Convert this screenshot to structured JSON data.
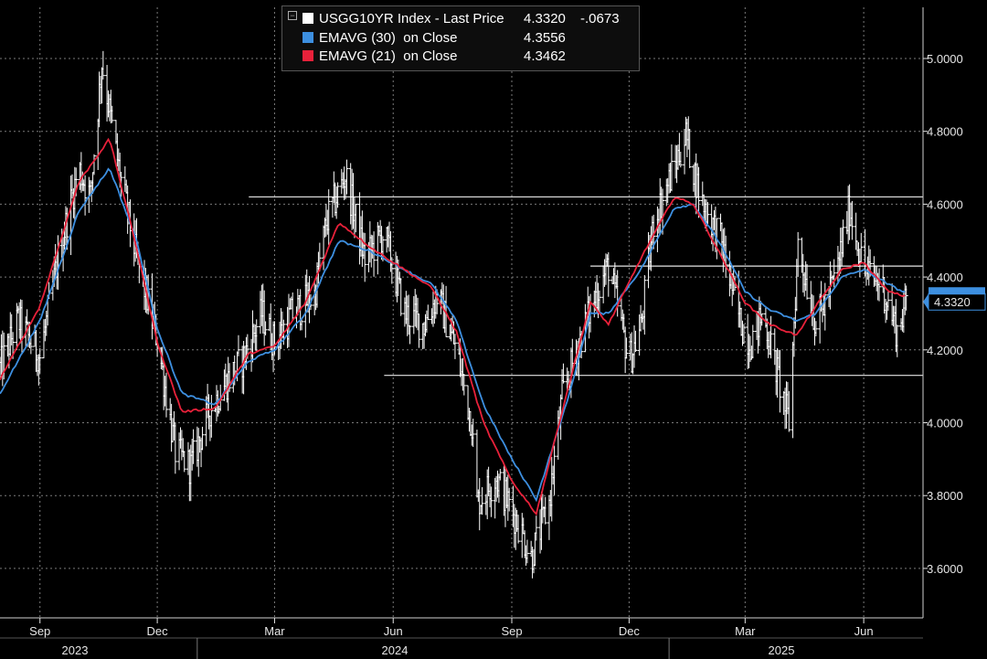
{
  "colors": {
    "background": "#000000",
    "grid": "#7a7a7a",
    "price": "#ffffff",
    "ema30": "#3d8fe0",
    "ema21": "#e8213a",
    "axis_text": "#e6e6e6",
    "last_price_tag_bg": "#ffffff",
    "last_price_tag_border": "#3d8fe0"
  },
  "legend": {
    "collapse_icon": "minus-box-icon",
    "rows": [
      {
        "swatch": "#ffffff",
        "name": "USGG10YR Index - Last Price",
        "value": "4.3320",
        "change": "-.0673"
      },
      {
        "swatch": "#3d8fe0",
        "name": "EMAVG (30)  on Close",
        "value": "4.3556",
        "change": ""
      },
      {
        "swatch": "#e8213a",
        "name": "EMAVG (21)  on Close",
        "value": "4.3462",
        "change": ""
      }
    ]
  },
  "last_price_tag": "4.3320",
  "chart_data": {
    "type": "line",
    "title": "",
    "xlabel": "",
    "ylabel": "",
    "ylim": [
      3.45,
      5.12
    ],
    "y_ticks": [
      "5.0000",
      "4.8000",
      "4.6000",
      "4.4000",
      "4.2000",
      "4.0000",
      "3.8000",
      "3.6000"
    ],
    "x_ticks": [
      "Sep",
      "Dec",
      "Mar",
      "Jun",
      "Sep",
      "Dec",
      "Mar",
      "Jun"
    ],
    "x_years": [
      "2023",
      "2024",
      "2025"
    ],
    "grid": true,
    "legend_position": "top-center",
    "horizontal_levels": [
      4.62,
      4.43,
      4.13
    ],
    "series": [
      {
        "name": "USGG10YR Index - Last Price",
        "x": [
          "2023-08-01",
          "2023-08-15",
          "2023-09-01",
          "2023-09-15",
          "2023-10-01",
          "2023-10-10",
          "2023-10-19",
          "2023-11-01",
          "2023-11-15",
          "2023-12-01",
          "2023-12-15",
          "2023-12-27",
          "2024-01-10",
          "2024-01-25",
          "2024-02-05",
          "2024-02-20",
          "2024-03-01",
          "2024-03-15",
          "2024-04-01",
          "2024-04-10",
          "2024-04-25",
          "2024-05-10",
          "2024-05-25",
          "2024-06-10",
          "2024-06-25",
          "2024-07-05",
          "2024-07-20",
          "2024-08-01",
          "2024-08-05",
          "2024-08-20",
          "2024-09-05",
          "2024-09-16",
          "2024-09-30",
          "2024-10-10",
          "2024-10-25",
          "2024-11-05",
          "2024-11-15",
          "2024-12-01",
          "2024-12-10",
          "2024-12-20",
          "2025-01-05",
          "2025-01-14",
          "2025-01-25",
          "2025-02-10",
          "2025-02-25",
          "2025-03-05",
          "2025-03-15",
          "2025-04-04",
          "2025-04-11",
          "2025-04-25",
          "2025-05-10",
          "2025-05-21",
          "2025-06-01",
          "2025-06-15",
          "2025-06-27",
          "2025-07-04"
        ],
        "values": [
          4.15,
          4.28,
          4.18,
          4.45,
          4.7,
          4.62,
          4.99,
          4.7,
          4.45,
          4.23,
          3.92,
          3.88,
          4.03,
          4.12,
          4.17,
          4.3,
          4.22,
          4.3,
          4.35,
          4.55,
          4.68,
          4.45,
          4.52,
          4.3,
          4.27,
          4.35,
          4.2,
          4.0,
          3.78,
          3.85,
          3.73,
          3.63,
          3.78,
          4.07,
          4.24,
          4.35,
          4.43,
          4.17,
          4.26,
          4.55,
          4.7,
          4.79,
          4.62,
          4.5,
          4.28,
          4.22,
          4.3,
          4.0,
          4.49,
          4.27,
          4.4,
          4.59,
          4.42,
          4.38,
          4.25,
          4.332
        ]
      },
      {
        "name": "EMAVG (30)  on Close",
        "x": [
          "2023-08-01",
          "2023-09-01",
          "2023-10-01",
          "2023-10-25",
          "2023-11-15",
          "2023-12-01",
          "2023-12-20",
          "2024-01-15",
          "2024-02-10",
          "2024-03-01",
          "2024-03-25",
          "2024-04-20",
          "2024-05-15",
          "2024-06-10",
          "2024-07-01",
          "2024-07-20",
          "2024-08-10",
          "2024-09-01",
          "2024-09-20",
          "2024-10-15",
          "2024-11-01",
          "2024-11-15",
          "2024-12-10",
          "2025-01-05",
          "2025-01-20",
          "2025-02-10",
          "2025-03-01",
          "2025-03-20",
          "2025-04-10",
          "2025-04-25",
          "2025-05-15",
          "2025-06-01",
          "2025-06-20",
          "2025-07-04"
        ],
        "values": [
          4.08,
          4.28,
          4.58,
          4.7,
          4.5,
          4.26,
          4.08,
          4.05,
          4.17,
          4.2,
          4.3,
          4.5,
          4.47,
          4.42,
          4.38,
          4.28,
          4.05,
          3.9,
          3.79,
          4.07,
          4.3,
          4.3,
          4.42,
          4.59,
          4.6,
          4.49,
          4.36,
          4.31,
          4.28,
          4.3,
          4.4,
          4.42,
          4.38,
          4.3556
        ]
      },
      {
        "name": "EMAVG (21)  on Close",
        "x": [
          "2023-08-01",
          "2023-09-01",
          "2023-10-01",
          "2023-10-25",
          "2023-11-15",
          "2023-12-01",
          "2023-12-20",
          "2024-01-15",
          "2024-02-10",
          "2024-03-01",
          "2024-03-25",
          "2024-04-20",
          "2024-05-15",
          "2024-06-10",
          "2024-07-01",
          "2024-07-20",
          "2024-08-10",
          "2024-09-01",
          "2024-09-20",
          "2024-10-15",
          "2024-11-01",
          "2024-11-15",
          "2024-12-10",
          "2025-01-05",
          "2025-01-20",
          "2025-02-10",
          "2025-03-01",
          "2025-03-20",
          "2025-04-10",
          "2025-04-25",
          "2025-05-15",
          "2025-06-01",
          "2025-06-20",
          "2025-07-04"
        ],
        "values": [
          4.12,
          4.32,
          4.66,
          4.78,
          4.48,
          4.22,
          4.03,
          4.04,
          4.19,
          4.21,
          4.33,
          4.55,
          4.48,
          4.42,
          4.37,
          4.25,
          4.0,
          3.84,
          3.75,
          4.1,
          4.33,
          4.27,
          4.45,
          4.62,
          4.6,
          4.46,
          4.33,
          4.27,
          4.24,
          4.32,
          4.42,
          4.44,
          4.36,
          4.3462
        ]
      }
    ]
  }
}
